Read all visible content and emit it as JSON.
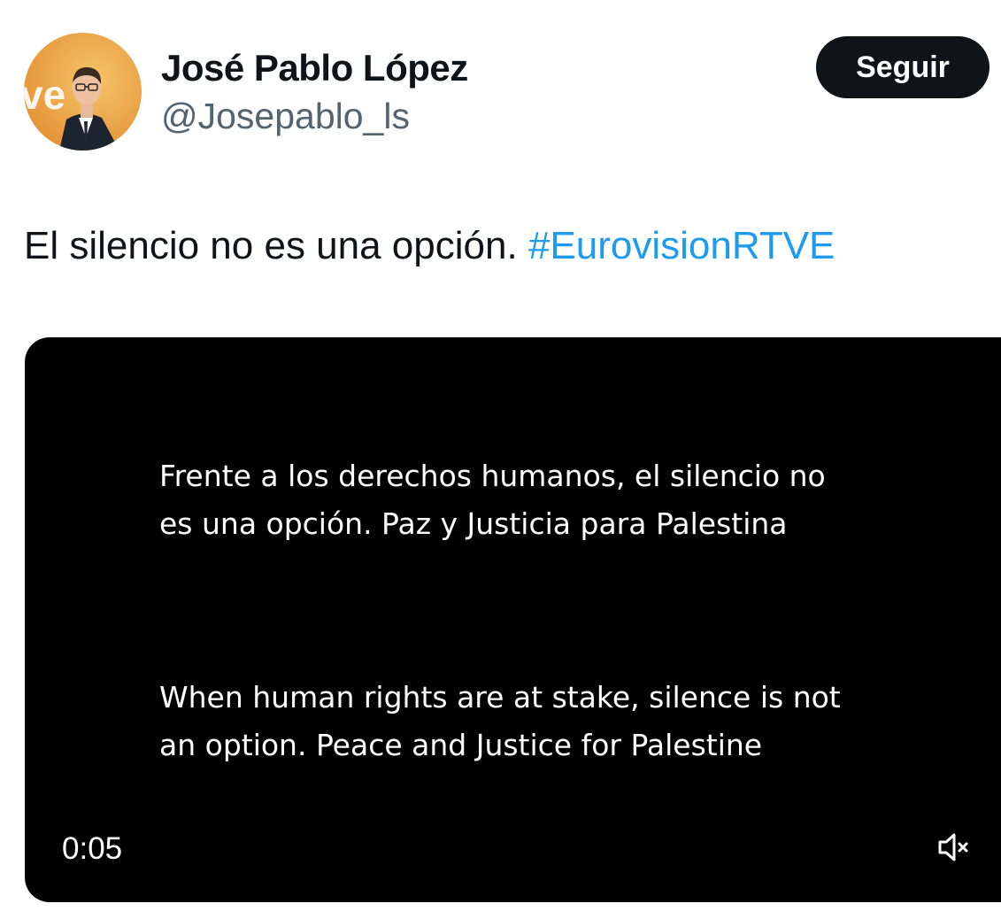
{
  "author": {
    "display_name": "José Pablo López",
    "handle": "@Josepablo_ls",
    "avatar_icon": "profile-photo-avatar",
    "avatar_background_text": "ve"
  },
  "actions": {
    "follow_label": "Seguir"
  },
  "tweet": {
    "text": "El silencio no es una opción.",
    "hashtag": "#EurovisionRTVE"
  },
  "video": {
    "caption_es": "Frente a los derechos humanos, el silencio no\nes una opción. Paz y Justicia para Palestina",
    "caption_en": "When human rights are at stake, silence is not\nan option. Peace and Justice for Palestine",
    "timestamp": "0:05",
    "mute_icon": "speaker-muted-icon"
  },
  "colors": {
    "hashtag": "#1d9bf0",
    "button_bg": "#0f1419",
    "handle": "#536471",
    "video_bg": "#000000"
  }
}
